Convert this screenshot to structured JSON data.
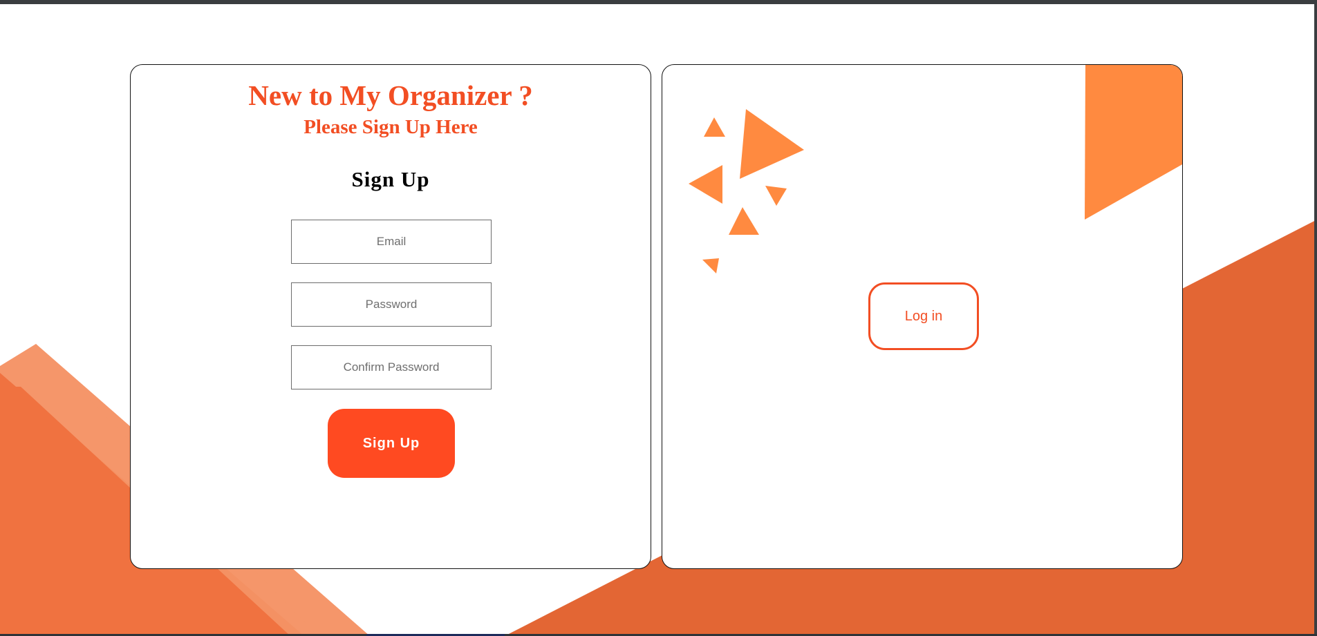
{
  "signup_panel": {
    "heading": "New to My Organizer ?",
    "subheading": "Please Sign Up Here",
    "form_title": "Sign Up",
    "email_placeholder": "Email",
    "password_placeholder": "Password",
    "confirm_placeholder": "Confirm Password",
    "submit_label": "Sign Up"
  },
  "login_panel": {
    "login_label": "Log in"
  },
  "colors": {
    "accent": "#f24e23",
    "button": "#ff4a21",
    "decor_light": "#f5966a",
    "decor_mid": "#f07240",
    "decor_dark": "#e36634",
    "triangles": "#ff8a40"
  }
}
